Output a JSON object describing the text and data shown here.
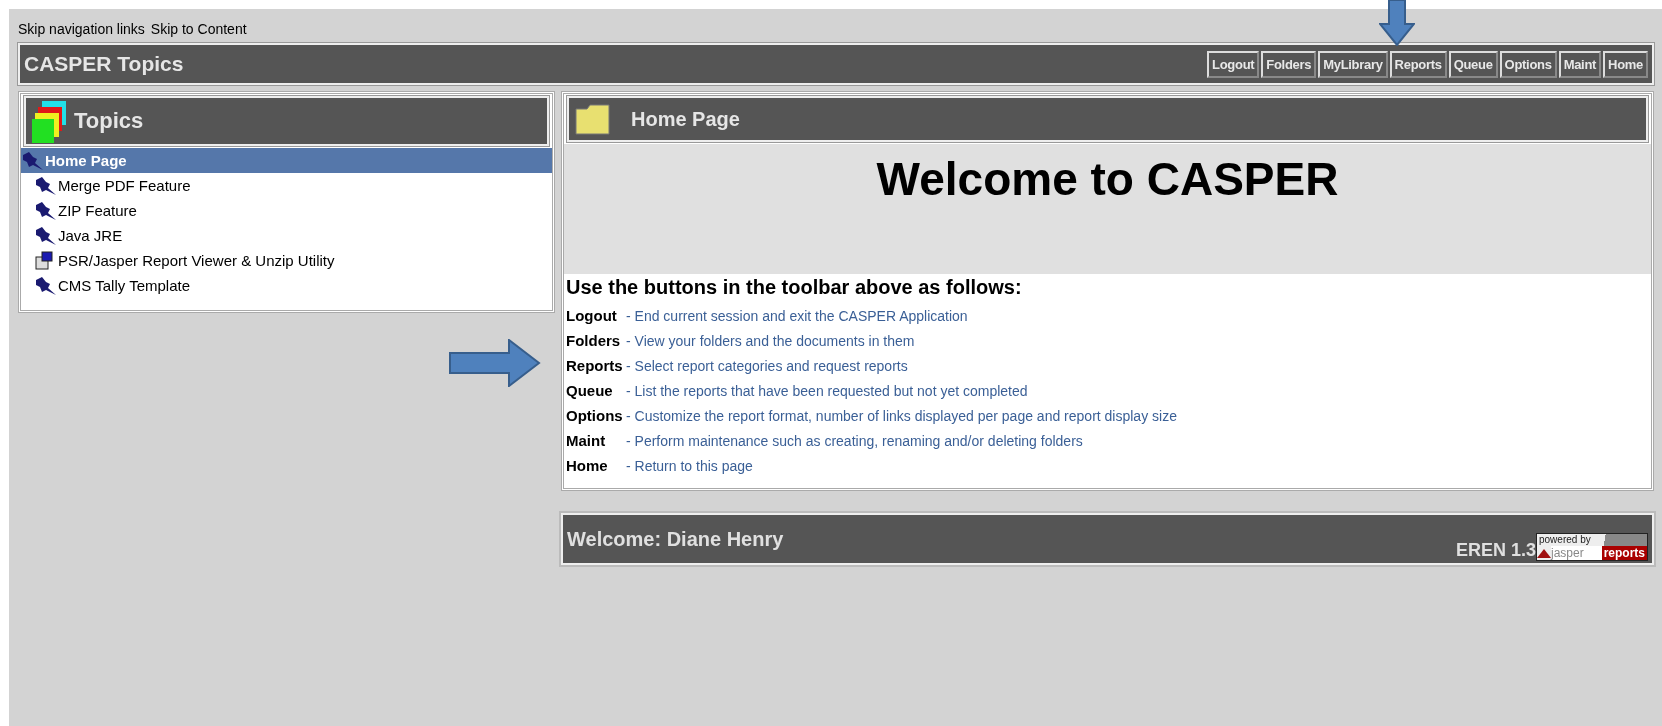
{
  "skip_links": [
    "Skip navigation links",
    "Skip to Content"
  ],
  "header": {
    "title": "CASPER Topics",
    "buttons": [
      {
        "label": "Logout"
      },
      {
        "label": "Folders"
      },
      {
        "label": "MyLibrary"
      },
      {
        "label": "Reports"
      },
      {
        "label": "Queue"
      },
      {
        "label": "Options"
      },
      {
        "label": "Maint"
      },
      {
        "label": "Home"
      }
    ]
  },
  "topics": {
    "title": "Topics",
    "items": [
      {
        "label": "Home Page",
        "kind": "pin",
        "selected": true,
        "children": [
          {
            "label": "Merge PDF Feature",
            "kind": "pin",
            "selected": false
          },
          {
            "label": "ZIP Feature",
            "kind": "pin",
            "selected": false
          },
          {
            "label": "Java JRE",
            "kind": "pin",
            "selected": false
          },
          {
            "label": "PSR/Jasper Report Viewer & Unzip Utility",
            "kind": "computer",
            "selected": false
          },
          {
            "label": "CMS Tally Template",
            "kind": "pin",
            "selected": false
          }
        ]
      }
    ]
  },
  "content": {
    "title": "Home Page",
    "welcome": "Welcome to CASPER",
    "intro": "Use the buttons in the toolbar above as follows:",
    "help": [
      {
        "button": "Logout",
        "description": "- End current session and exit the CASPER Application"
      },
      {
        "button": "Folders",
        "description": "- View your folders and the documents in them"
      },
      {
        "button": "Reports",
        "description": "- Select report categories and request reports"
      },
      {
        "button": "Queue",
        "description": "- List the reports that have been requested but not yet completed"
      },
      {
        "button": "Options",
        "description": "- Customize the report format, number of links displayed per page and report display size"
      },
      {
        "button": "Maint",
        "description": "- Perform maintenance such as creating, renaming and/or deleting folders"
      },
      {
        "button": "Home",
        "description": "- Return to this page"
      }
    ]
  },
  "footer": {
    "user": "Welcome: Diane Henry",
    "version": "EREN 1.3",
    "logo": {
      "top": "powered by",
      "left": "jasper",
      "right": "reports"
    }
  }
}
